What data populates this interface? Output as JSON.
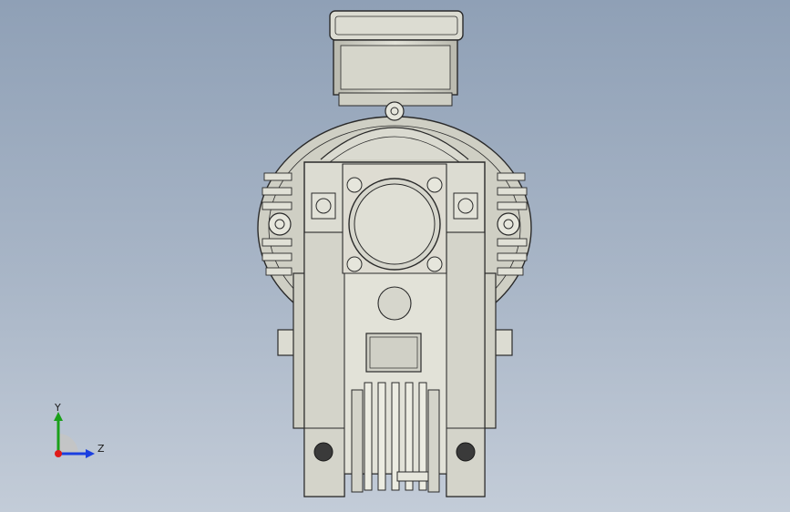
{
  "viewport": {
    "background_top": "#8fa0b6",
    "background_bottom": "#c3ccd8",
    "model_fill": "#d8d8cc",
    "model_stroke": "#2a2a2a",
    "model_shade": "#b9b9ae"
  },
  "triad": {
    "y_label": "Y",
    "z_label": "Z",
    "y_color": "#1aa01a",
    "z_color": "#1a3fe0",
    "x_color": "#e01a1a"
  }
}
